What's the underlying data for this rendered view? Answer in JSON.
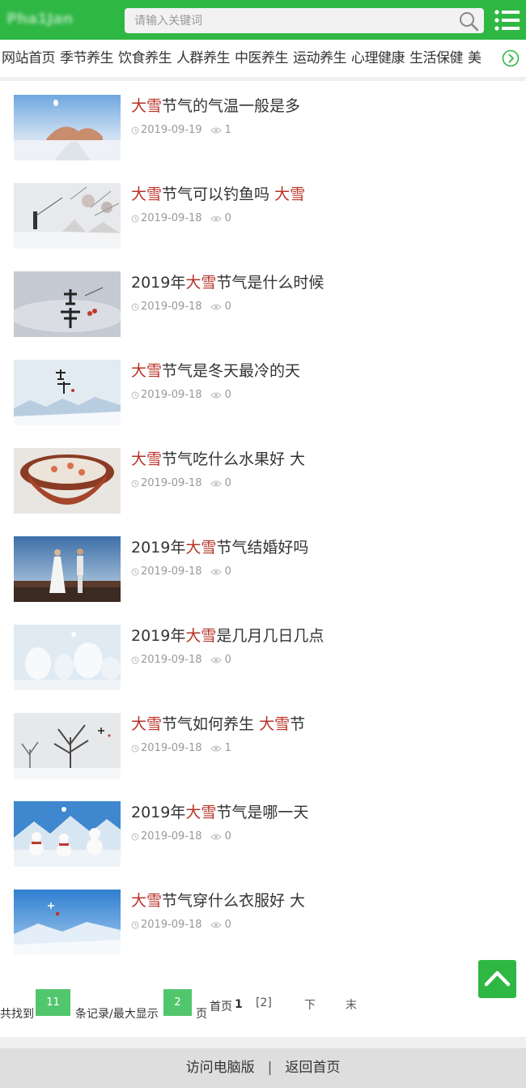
{
  "header": {
    "logo_text": "Pha1Jan",
    "search_placeholder": "请输入关键词",
    "brand_color": "#2fb744"
  },
  "nav": {
    "items": [
      "网站首页",
      "季节养生",
      "饮食养生",
      "人群养生",
      "中医养生",
      "运动养生",
      "心理健康",
      "生活保健",
      "美"
    ]
  },
  "articles": [
    {
      "pre": "",
      "hl": "大雪",
      "post": "节气的气温一般是多",
      "hl2": "",
      "post2": "",
      "date": "2019-09-19",
      "views": "1"
    },
    {
      "pre": "",
      "hl": "大雪",
      "post": "节气可以钓鱼吗 ",
      "hl2": "大雪",
      "post2": "",
      "date": "2019-09-18",
      "views": "0"
    },
    {
      "pre": "2019年",
      "hl": "大雪",
      "post": "节气是什么时候",
      "hl2": "",
      "post2": "",
      "date": "2019-09-18",
      "views": "0"
    },
    {
      "pre": "",
      "hl": "大雪",
      "post": "节气是冬天最冷的天",
      "hl2": "",
      "post2": "",
      "date": "2019-09-18",
      "views": "0"
    },
    {
      "pre": "",
      "hl": "大雪",
      "post": "节气吃什么水果好 大",
      "hl2": "",
      "post2": "",
      "date": "2019-09-18",
      "views": "0"
    },
    {
      "pre": "2019年",
      "hl": "大雪",
      "post": "节气结婚好吗",
      "hl2": "",
      "post2": "",
      "date": "2019-09-18",
      "views": "0"
    },
    {
      "pre": "2019年",
      "hl": "大雪",
      "post": "是几月几日几点",
      "hl2": "",
      "post2": "",
      "date": "2019-09-18",
      "views": "0"
    },
    {
      "pre": "",
      "hl": "大雪",
      "post": "节气如何养生 ",
      "hl2": "大雪",
      "post2": "节",
      "date": "2019-09-18",
      "views": "1"
    },
    {
      "pre": "2019年",
      "hl": "大雪",
      "post": "节气是哪一天",
      "hl2": "",
      "post2": "",
      "date": "2019-09-18",
      "views": "0"
    },
    {
      "pre": "",
      "hl": "大雪",
      "post": "节气穿什么衣服好 大",
      "hl2": "",
      "post2": "",
      "date": "2019-09-18",
      "views": "0"
    }
  ],
  "pager": {
    "total_prefix": "共找到",
    "total": "11",
    "mid": "条记录/最大显示",
    "max_pages": "2",
    "suffix": "页",
    "first": "首页",
    "current": "1",
    "page2": "[2]",
    "next": "下",
    "last": "末"
  },
  "footer": {
    "desktop": "访问电脑版",
    "separator": "|",
    "home": "返回首页"
  }
}
